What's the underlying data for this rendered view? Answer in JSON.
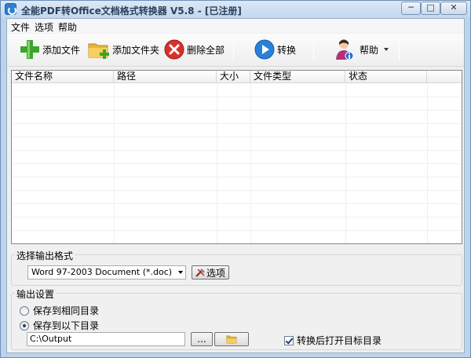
{
  "window": {
    "title": "全能PDF转Office文档格式转换器 V5.8  -  [已注册]",
    "min_glyph": "─",
    "max_glyph": "□",
    "close_glyph": "✕"
  },
  "menu": {
    "items": [
      {
        "label": "文件"
      },
      {
        "label": "选项"
      },
      {
        "label": "帮助"
      }
    ]
  },
  "toolbar": {
    "add_file_label": "添加文件",
    "add_folder_label": "添加文件夹",
    "delete_all_label": "删除全部",
    "convert_label": "转换",
    "help_label": "帮助"
  },
  "file_list": {
    "columns": [
      {
        "label": "文件名称"
      },
      {
        "label": "路径"
      },
      {
        "label": "大小"
      },
      {
        "label": "文件类型"
      },
      {
        "label": "状态"
      }
    ],
    "rows": []
  },
  "output_format": {
    "group_label": "选择输出格式",
    "selected": "Word 97-2003 Document (*.doc)",
    "options_button_label": "选项"
  },
  "output_settings": {
    "group_label": "输出设置",
    "radio_same_dir": "保存到相同目录",
    "radio_custom_dir": "保存到以下目录",
    "selected_radio": "custom",
    "path_value": "C:\\Output",
    "browse_label": "...",
    "open_after_label": "转换后打开目标目录",
    "open_after_checked": true
  },
  "colors": {
    "titlebar": "#c3d7ee",
    "face": "#f0f0f0"
  }
}
